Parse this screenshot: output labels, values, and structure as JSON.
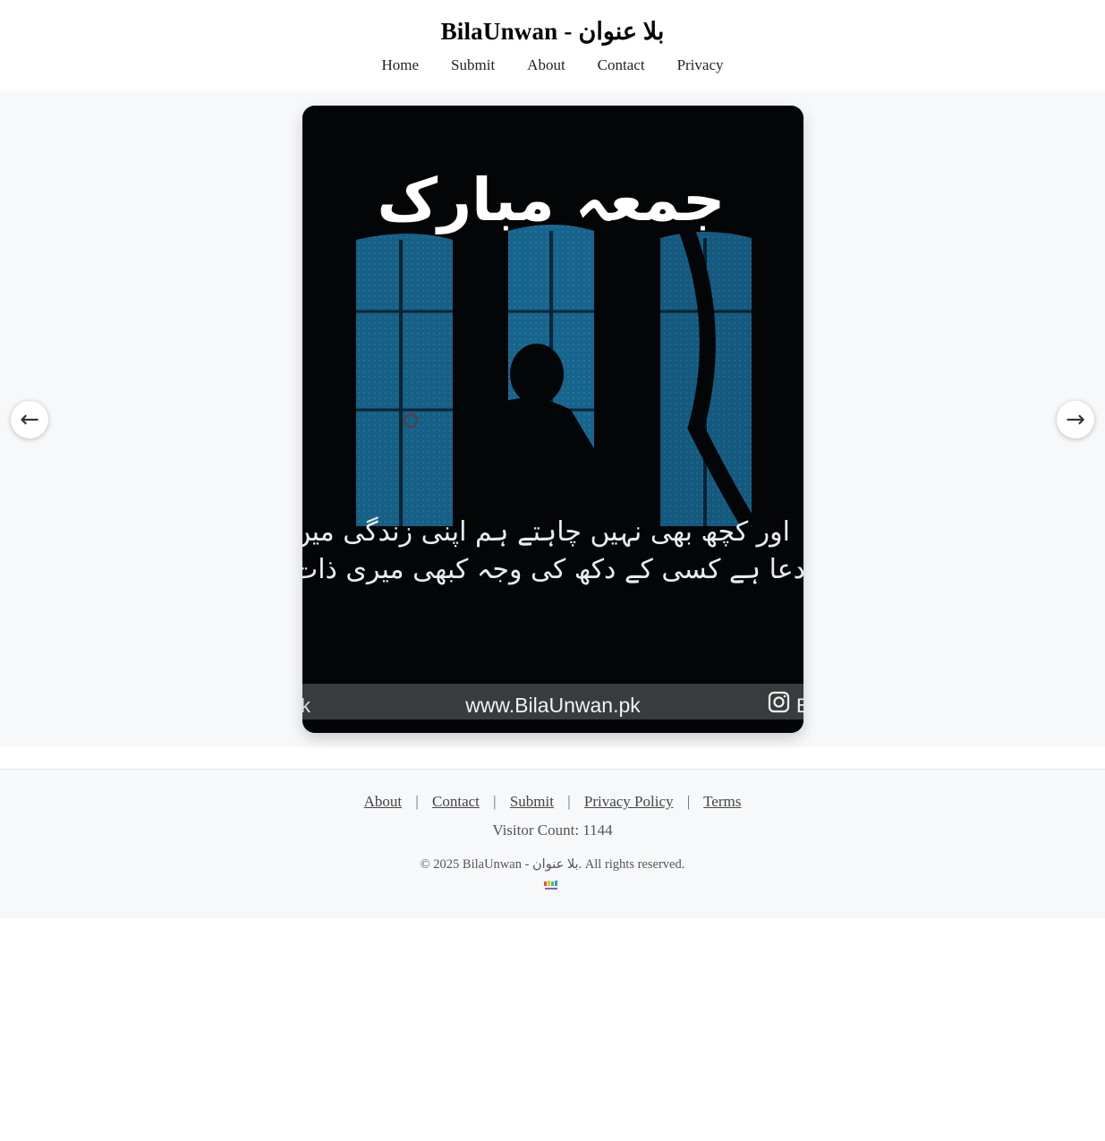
{
  "site": {
    "title": "BilaUnwan - بلا عنوان"
  },
  "nav": {
    "items": [
      "Home",
      "Submit",
      "About",
      "Contact",
      "Privacy"
    ]
  },
  "slide": {
    "heading": "جمعہ مبارک",
    "line1": "اور کچھ بھی نہیں چاہتے ہم اپنی زندگی میں یا رب",
    "line2": "دعا ہے کسی کے دکھ کی وجہ کبھی میری ذات نہ ہو",
    "url": "www.BilaUnwan.pk",
    "left_fragment": "k",
    "right_fragment": "B"
  },
  "carousel": {
    "prev_icon": "←",
    "next_icon": "→"
  },
  "footer": {
    "links": [
      "About",
      "Contact",
      "Submit",
      "Privacy Policy",
      "Terms"
    ],
    "separator": "|",
    "visitor_count": "Visitor Count: 1144",
    "copyright": "© 2025 BilaUnwan - بلا عنوان. All rights reserved."
  },
  "colors": {
    "background": "#f7f8fa",
    "slide_background": "#040506",
    "window_blue": "#1a6f9c",
    "banner": "#3a3b3d"
  }
}
